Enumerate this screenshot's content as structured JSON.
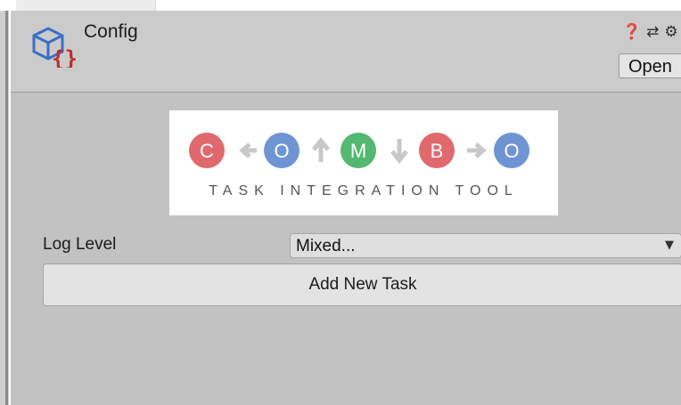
{
  "header": {
    "title": "Config",
    "open_label": "Open",
    "icons": [
      "help-icon",
      "preset-sliders-icon",
      "gear-icon"
    ]
  },
  "logo": {
    "letters": [
      "C",
      "O",
      "M",
      "B",
      "O"
    ],
    "caption": "TASK INTEGRATION TOOL",
    "colors": {
      "red": "#e0696e",
      "blue": "#6f94d4",
      "green": "#55b870",
      "arrow": "#c8c8c8"
    }
  },
  "settings": {
    "log_level_label": "Log Level",
    "log_level_value": "Mixed...",
    "add_task_label": "Add New Task"
  }
}
